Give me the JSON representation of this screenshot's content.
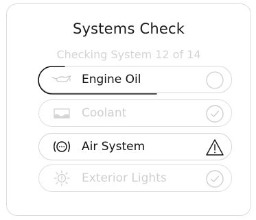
{
  "header": {
    "title": "Systems Check",
    "subtitle": "Checking System 12 of 14"
  },
  "progress": {
    "current_system": 12,
    "total_systems": 14
  },
  "systems": [
    {
      "label": "Engine Oil",
      "icon": "oil-can-icon",
      "status": "checking",
      "status_icon": "circle-empty-icon"
    },
    {
      "label": "Coolant",
      "icon": "coolant-icon",
      "status": "ok",
      "status_icon": "check-circle-icon"
    },
    {
      "label": "Air System",
      "icon": "air-brake-icon",
      "status": "warning",
      "status_icon": "warning-triangle-icon"
    },
    {
      "label": "Exterior Lights",
      "icon": "exterior-light-icon",
      "status": "ok",
      "status_icon": "check-circle-icon"
    }
  ],
  "colors": {
    "text_dark": "#111111",
    "text_muted": "#cfcfcf",
    "border": "#dedede"
  }
}
